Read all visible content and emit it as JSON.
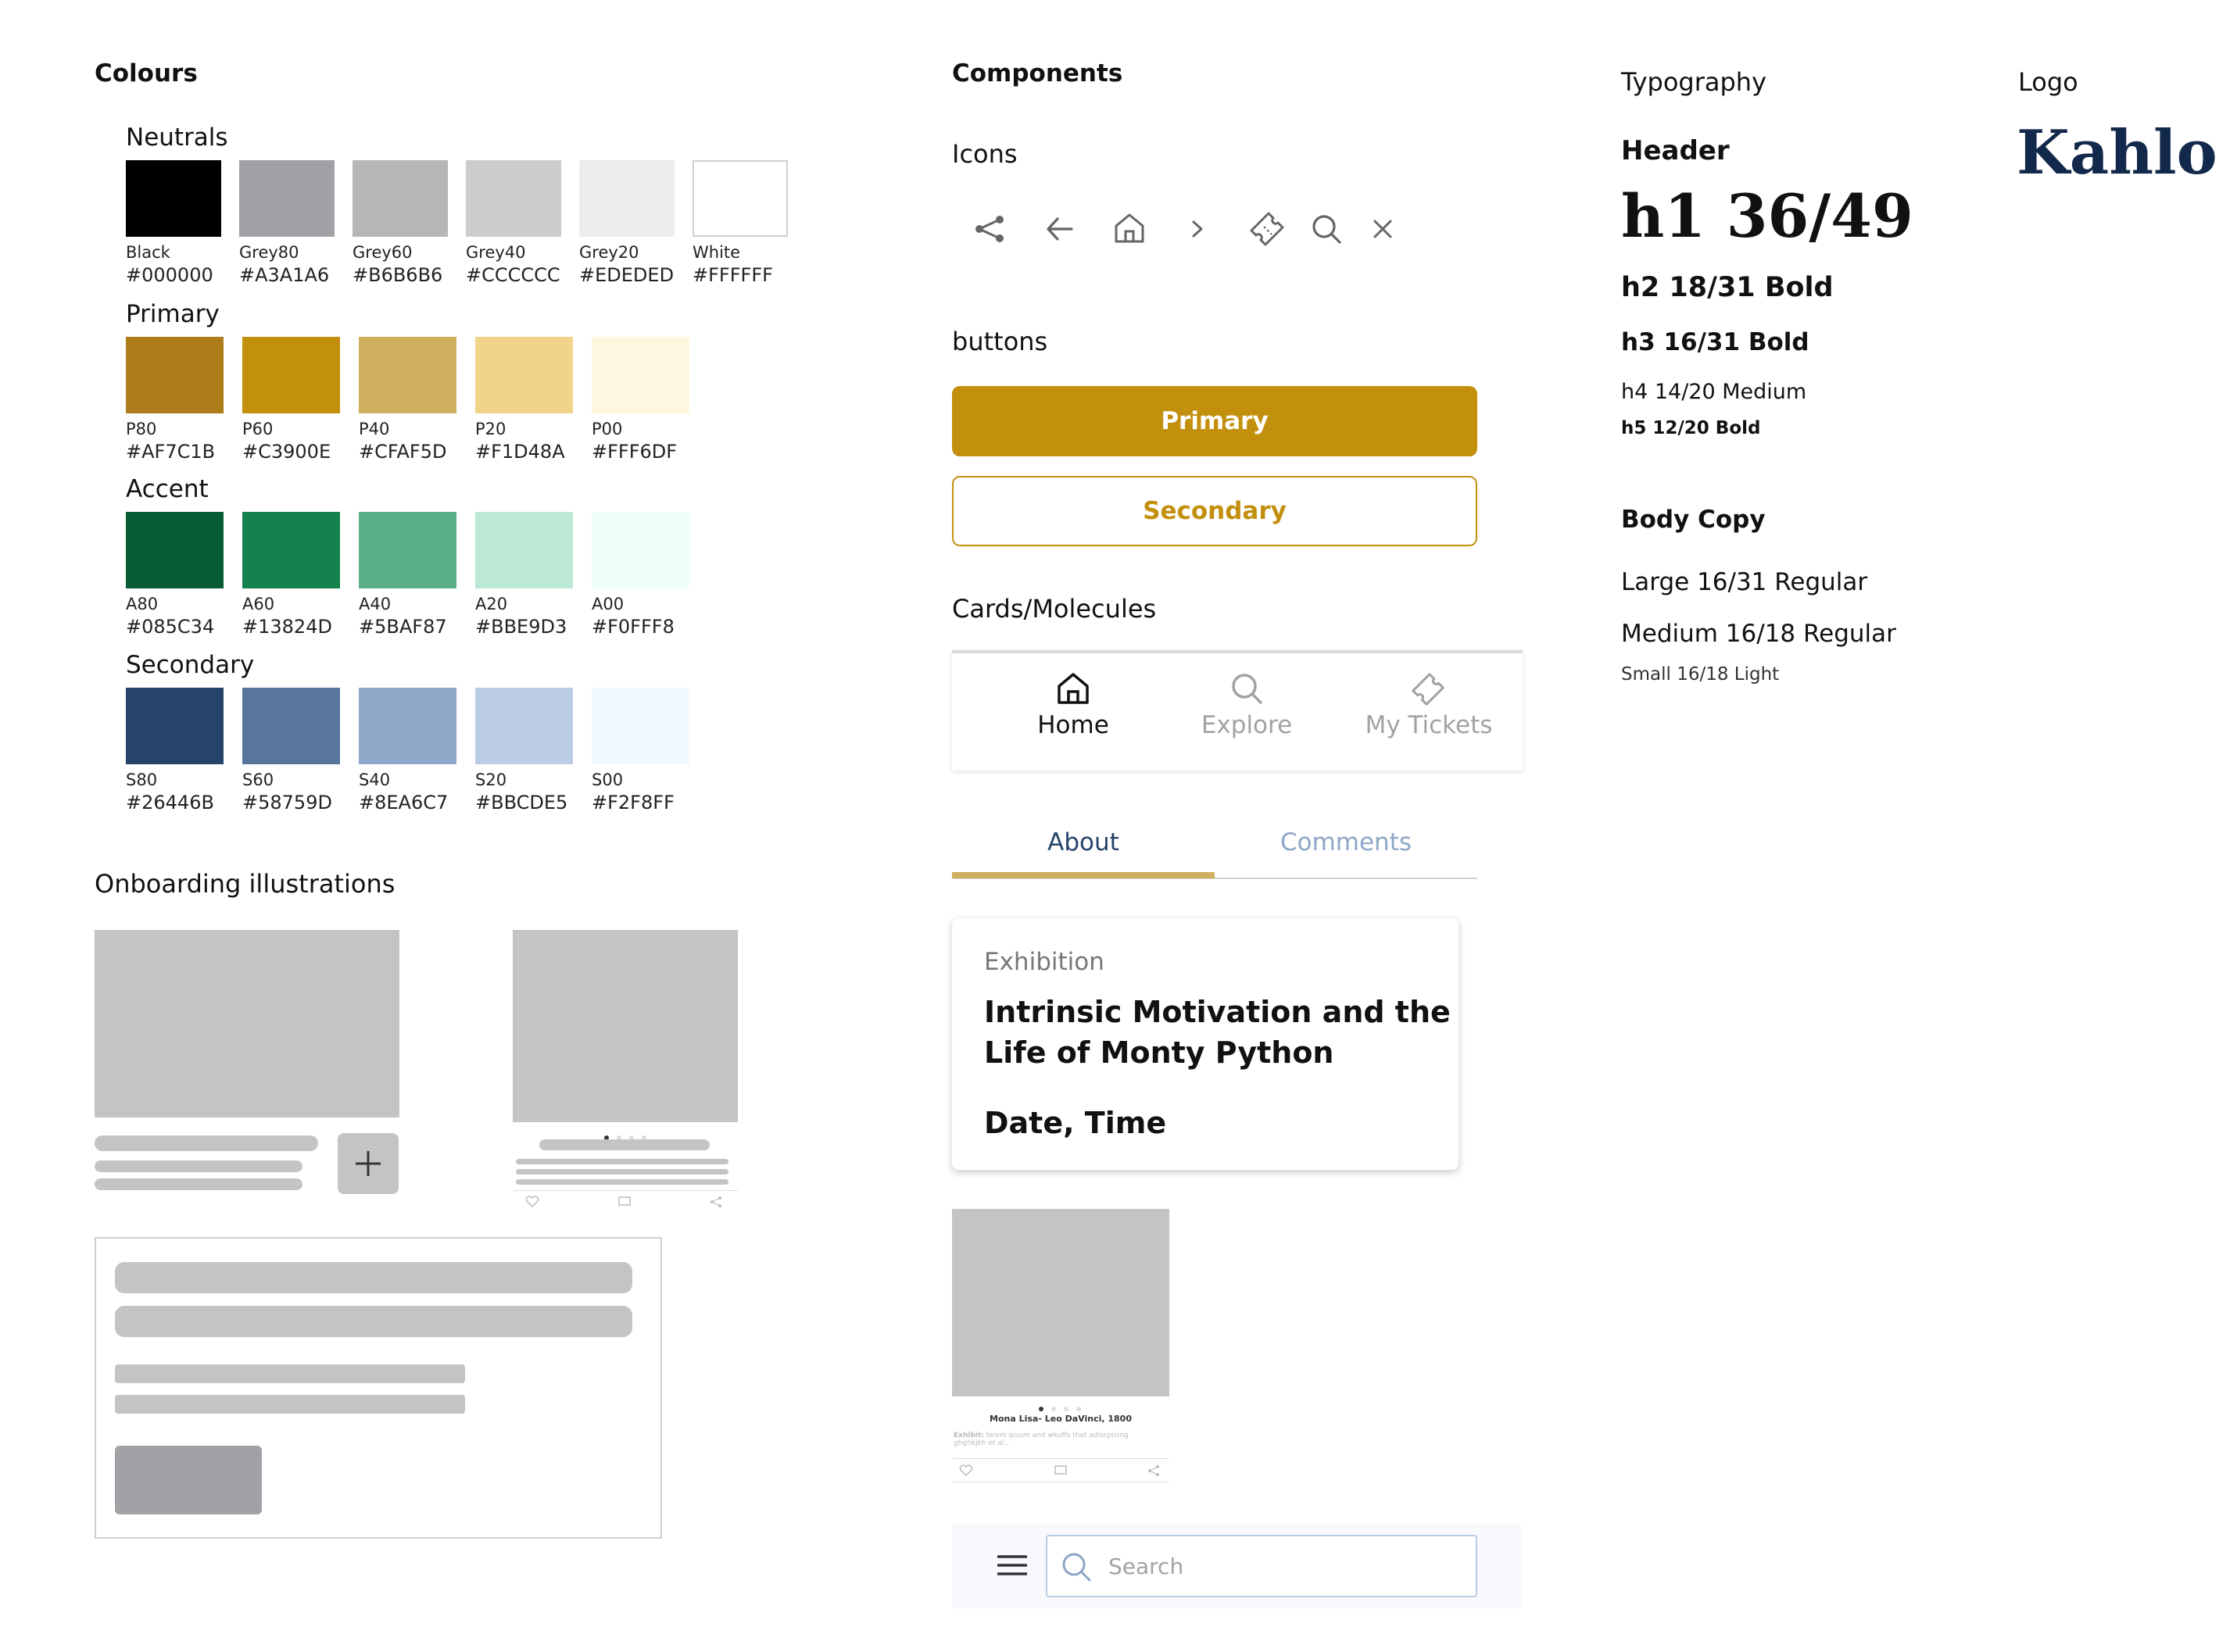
{
  "colours": {
    "title": "Colours",
    "groups": [
      {
        "name": "Neutrals",
        "swatches": [
          {
            "name": "Black",
            "hex": "#000000"
          },
          {
            "name": "Grey80",
            "hex": "#A3A1A6"
          },
          {
            "name": "Grey60",
            "hex": "#B6B6B6"
          },
          {
            "name": "Grey40",
            "hex": "#CCCCCC"
          },
          {
            "name": "Grey20",
            "hex": "#EDEDED"
          },
          {
            "name": "White",
            "hex": "#FFFFFF"
          }
        ]
      },
      {
        "name": "Primary",
        "swatches": [
          {
            "name": "P80",
            "hex": "#AF7C1B"
          },
          {
            "name": "P60",
            "hex": "#C3900E"
          },
          {
            "name": "P40",
            "hex": "#CFAF5D"
          },
          {
            "name": "P20",
            "hex": "#F1D48A"
          },
          {
            "name": "P00",
            "hex": "#FFF6DF"
          }
        ]
      },
      {
        "name": "Accent",
        "swatches": [
          {
            "name": "A80",
            "hex": "#085C34"
          },
          {
            "name": "A60",
            "hex": "#13824D"
          },
          {
            "name": "A40",
            "hex": "#5BAF87"
          },
          {
            "name": "A20",
            "hex": "#BBE9D3"
          },
          {
            "name": "A00",
            "hex": "#F0FFF8"
          }
        ]
      },
      {
        "name": "Secondary",
        "swatches": [
          {
            "name": "S80",
            "hex": "#26446B"
          },
          {
            "name": "S60",
            "hex": "#58759D"
          },
          {
            "name": "S40",
            "hex": "#8EA6C7"
          },
          {
            "name": "S20",
            "hex": "#BBCDE5"
          },
          {
            "name": "S00",
            "hex": "#F2F8FF"
          }
        ]
      }
    ]
  },
  "onboarding": {
    "title": "Onboarding illustrations"
  },
  "components": {
    "title": "Components",
    "icons_label": "Icons",
    "icons": [
      "share-icon",
      "arrow-left-icon",
      "home-icon",
      "chevron-right-icon",
      "ticket-icon",
      "search-icon",
      "close-icon"
    ],
    "buttons_label": "buttons",
    "primary_button": "Primary",
    "secondary_button": "Secondary",
    "cards_label": "Cards/Molecules",
    "nav": [
      {
        "label": "Home",
        "icon": "home-icon",
        "active": true
      },
      {
        "label": "Explore",
        "icon": "search-icon",
        "active": false
      },
      {
        "label": "My Tickets",
        "icon": "ticket-icon",
        "active": false
      }
    ],
    "tabs": [
      {
        "label": "About",
        "active": true
      },
      {
        "label": "Comments",
        "active": false
      }
    ],
    "event_card": {
      "category": "Exhibition",
      "title_line1": "Intrinsic Motivation and the",
      "title_line2": "Life of Monty Python",
      "datetime": "Date, Time"
    },
    "art_card": {
      "caption": "Mona Lisa- Leo DaVinci, 1800",
      "desc_label": "Exhibit:",
      "desc": "lorem ipsum and wkuffs that adiscpising",
      "desc2": "ghghkjkh et al..."
    },
    "search_placeholder": "Search"
  },
  "typography": {
    "title": "Typography",
    "header_label": "Header",
    "h1": "h1 36/49",
    "h2": "h2 18/31 Bold",
    "h3": "h3 16/31 Bold",
    "h4": "h4 14/20 Medium",
    "h5": "h5 12/20 Bold",
    "body_label": "Body Copy",
    "large": "Large 16/31 Regular",
    "medium": "Medium 16/18 Regular",
    "small": "Small 16/18 Light"
  },
  "logo": {
    "label": "Logo",
    "text": "Kahlo",
    "color": "#13294B"
  },
  "colors": {
    "primary": "#C3900E",
    "tab_active": "#CFAF5D",
    "tab_inactive_text": "#8EA6C7",
    "muted": "#A3A1A6"
  }
}
